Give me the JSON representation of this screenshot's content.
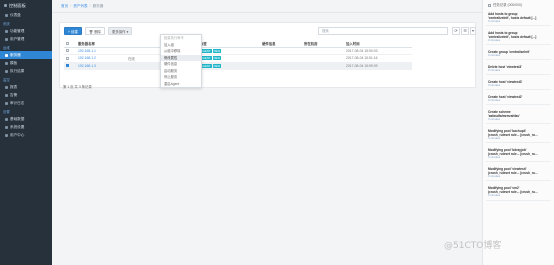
{
  "brand": "控制面板",
  "sidebar": {
    "top_items": [
      {
        "label": "仪表盘",
        "icon": "dashboard-icon"
      }
    ],
    "sections": [
      {
        "title": "系统",
        "items": [
          {
            "label": "功能管理",
            "icon": "module-icon"
          },
          {
            "label": "用户管理",
            "icon": "user-icon"
          }
        ]
      },
      {
        "title": "运维",
        "items": [
          {
            "label": "服务器",
            "icon": "server-icon",
            "active": true
          },
          {
            "label": "模板",
            "icon": "template-icon"
          },
          {
            "label": "执行结果",
            "icon": "result-icon"
          }
        ]
      },
      {
        "title": "监控",
        "items": [
          {
            "label": "报表",
            "icon": "report-icon"
          },
          {
            "label": "告警",
            "icon": "alert-icon"
          },
          {
            "label": "审计日志",
            "icon": "audit-icon"
          }
        ]
      },
      {
        "title": "设置",
        "items": [
          {
            "label": "基础数据",
            "icon": "data-icon"
          },
          {
            "label": "系统设置",
            "icon": "settings-icon"
          },
          {
            "label": "用户中心",
            "icon": "profile-icon"
          }
        ]
      }
    ]
  },
  "breadcrumb": [
    "首页",
    "资产列表",
    "服务器"
  ],
  "toolbar": {
    "create": "+ 创建",
    "delete": "删除",
    "batch": "更多操作",
    "search_placeholder": "搜索",
    "refresh_icon": "refresh-icon",
    "columns_icon": "columns-icon",
    "grid_icon": "grid-icon"
  },
  "dropdown": [
    "批量执行命令",
    "加入组",
    "从组中移除",
    "修改属性",
    "硬件信息",
    "启动服务",
    "停止服务",
    "重启Agent"
  ],
  "table": {
    "headers": [
      "服务器名称",
      "",
      "状态",
      "标签",
      "硬件信息",
      "所在机房",
      "加入时间"
    ],
    "rows": [
      {
        "name": "192.168.1.1",
        "group": "",
        "status": "",
        "tags": [
          "AGENT",
          "NEW"
        ],
        "hw": "",
        "room": "",
        "time": "2017-08-04 15:50:03",
        "checked": false
      },
      {
        "name": "192.168.1.2",
        "group": "在线",
        "status": "",
        "tags": [
          "AGENT",
          "NEW"
        ],
        "hw": "",
        "room": "",
        "time": "2017-08-04 15:51:16",
        "checked": false
      },
      {
        "name": "192.168.1.3",
        "group": "",
        "status": "在线",
        "tags": [
          "AGENT",
          "NEW"
        ],
        "hw": "",
        "room": "",
        "time": "2017-08-04 15:59:09",
        "checked": true
      }
    ]
  },
  "pagination": "第 1 页 共 3 条记录",
  "notifications": {
    "header": "任务记录 (000/000)",
    "items": [
      {
        "title": "Add hosts to group",
        "detail": "'centralizeInit', hosts default [...]",
        "meta": "3 minutes"
      },
      {
        "title": "Add hosts to group",
        "detail": "'centralizeInit', hosts default [...]",
        "meta": "3 minutes"
      },
      {
        "title": "Create group 'centralizeInit'",
        "detail": "",
        "meta": "3 minutes"
      },
      {
        "title": "Delete host 'viewtest3'",
        "detail": "",
        "meta": "3 minutes"
      },
      {
        "title": "Create host 'viewtest3'",
        "detail": "",
        "meta": "3 minutes"
      },
      {
        "title": "Create host 'viewtest2'",
        "detail": "",
        "meta": "3 minutes"
      },
      {
        "title": "Create scheme",
        "detail": "'asfasdfa/mrmrahfas'",
        "meta": "3 minutes"
      },
      {
        "title": "Modifying pool 'bachup4'",
        "detail": "(crush_ruleset rule... [crush_ru...",
        "meta": "3 minutes"
      },
      {
        "title": "Modifying pool 'bdrayjob'",
        "detail": "(crush_ruleset rule... [crush_ru...",
        "meta": "3 minutes"
      },
      {
        "title": "Modifying pool 'viewtesti'",
        "detail": "(crush_ruleset rule... [crush_ru...",
        "meta": "3 minutes"
      },
      {
        "title": "Modifying pool 'vm2'",
        "detail": "(crush_ruleset rule... [crush_ru...",
        "meta": "3 minutes"
      }
    ]
  },
  "watermark": "@51CTO博客",
  "colors": {
    "sidebar": "#26313c",
    "accent": "#2f86d4",
    "tag": "#1fb5c9"
  }
}
